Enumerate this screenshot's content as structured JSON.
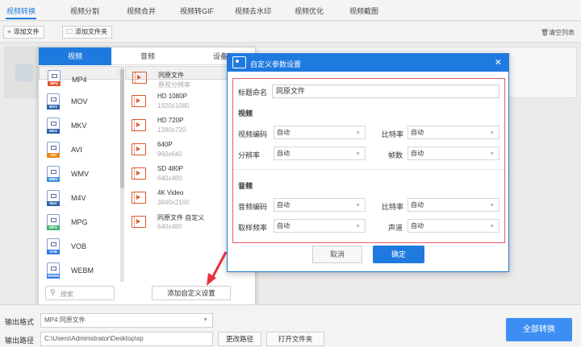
{
  "top_tabs": [
    "视频转换",
    "视频分割",
    "视频合并",
    "视频转GIF",
    "视频去水印",
    "视频优化",
    "视频截图"
  ],
  "toolbar": {
    "add_file": "添加文件",
    "add_folder": "添加文件夹",
    "clear_list": "清空列表"
  },
  "format_panel": {
    "tabs": [
      "视频",
      "音频",
      "设备"
    ],
    "formats": [
      "MP4",
      "MOV",
      "MKV",
      "AVI",
      "WMV",
      "M4V",
      "MPG",
      "VOB",
      "WEBM"
    ],
    "format_colors": [
      "#e0592b",
      "#2f5fa8",
      "#2f5fa8",
      "#e8861c",
      "#3e8fd6",
      "#2f5fa8",
      "#3fb36a",
      "#2f7ae0",
      "#2f7ae0"
    ],
    "resolutions": [
      {
        "name": "同原文件",
        "size": "原视分辨率"
      },
      {
        "name": "HD 1080P",
        "size": "1920x1080"
      },
      {
        "name": "HD 720P",
        "size": "1280x720"
      },
      {
        "name": "640P",
        "size": "960x640"
      },
      {
        "name": "SD 480P",
        "size": "640x480"
      },
      {
        "name": "4K Video",
        "size": "3840x2160"
      },
      {
        "name": "同原文件 自定义",
        "size": "640x480"
      }
    ],
    "search_placeholder": "搜索",
    "add_custom": "添加自定义设置"
  },
  "dialog": {
    "title": "自定义参数设置",
    "name_label": "标题命名",
    "name_value": "同原文件",
    "video_header": "视频",
    "video_codec_label": "视频编码",
    "video_codec": "自动",
    "video_bitrate_label": "比特率",
    "video_bitrate": "自动",
    "resolution_label": "分辨率",
    "resolution": "自动",
    "fps_label": "帧数",
    "fps": "自动",
    "audio_header": "音频",
    "audio_codec_label": "音频编码",
    "audio_codec": "自动",
    "audio_bitrate_label": "比特率",
    "audio_bitrate": "自动",
    "sample_rate_label": "取样频率",
    "sample_rate": "自动",
    "channel_label": "声道",
    "channel": "自动",
    "cancel": "取消",
    "ok": "确定"
  },
  "bottom": {
    "output_format_label": "输出格式",
    "output_format_value": "MP4  同原文件",
    "output_path_label": "输出路径",
    "output_path_value": "C:\\Users\\Administrator\\Desktop\\sp",
    "change_path": "更改路径",
    "open_folder": "打开文件夹",
    "convert_all": "全部转换"
  },
  "colors": {
    "accent": "#1f7ae0",
    "highlight_border": "#e85b66",
    "arrow": "#e8323e"
  }
}
